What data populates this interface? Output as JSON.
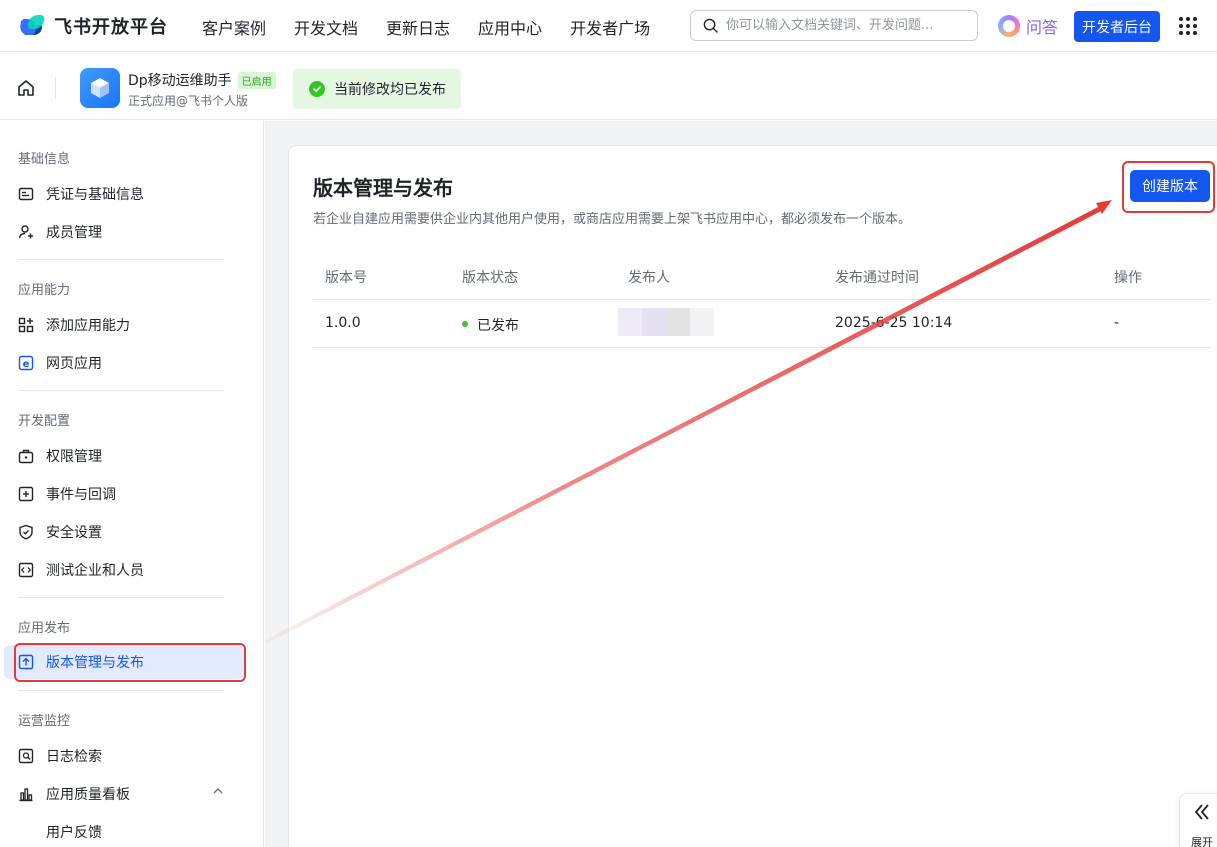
{
  "topnav": {
    "logo_text": "飞书开放平台",
    "links": [
      "客户案例",
      "开发文档",
      "更新日志",
      "应用中心",
      "开发者广场"
    ],
    "search_placeholder": "你可以输入文档关键词、开发问题...",
    "wenda_label": "问答",
    "dev_console_label": "开发者后台"
  },
  "appbar": {
    "app_name": "Dp移动运维助手",
    "app_badge": "已启用",
    "app_subtitle": "正式应用@飞书个人版",
    "publish_status": "当前修改均已发布"
  },
  "sidebar": {
    "groups": [
      {
        "label": "基础信息",
        "items": [
          "凭证与基础信息",
          "成员管理"
        ]
      },
      {
        "label": "应用能力",
        "items": [
          "添加应用能力",
          "网页应用"
        ]
      },
      {
        "label": "开发配置",
        "items": [
          "权限管理",
          "事件与回调",
          "安全设置",
          "测试企业和人员"
        ]
      },
      {
        "label": "应用发布",
        "items": [
          "版本管理与发布"
        ]
      },
      {
        "label": "运营监控",
        "items": [
          "日志检索",
          "应用质量看板",
          "用户反馈"
        ]
      }
    ]
  },
  "main": {
    "title": "版本管理与发布",
    "description": "若企业自建应用需要供企业内其他用户使用，或商店应用需要上架飞书应用中心，都必须发布一个版本。",
    "create_button": "创建版本",
    "table": {
      "headers": [
        "版本号",
        "版本状态",
        "发布人",
        "发布通过时间",
        "操作"
      ],
      "rows": [
        {
          "version": "1.0.0",
          "status": "已发布",
          "publish_time": "2025-6-25 10:14",
          "action": "-"
        }
      ]
    }
  },
  "expand_label": "展开",
  "colors": {
    "primary": "#1456f0",
    "success": "#34c724",
    "annotation_red": "#e33b3b",
    "active_bg": "#e1eaff"
  }
}
